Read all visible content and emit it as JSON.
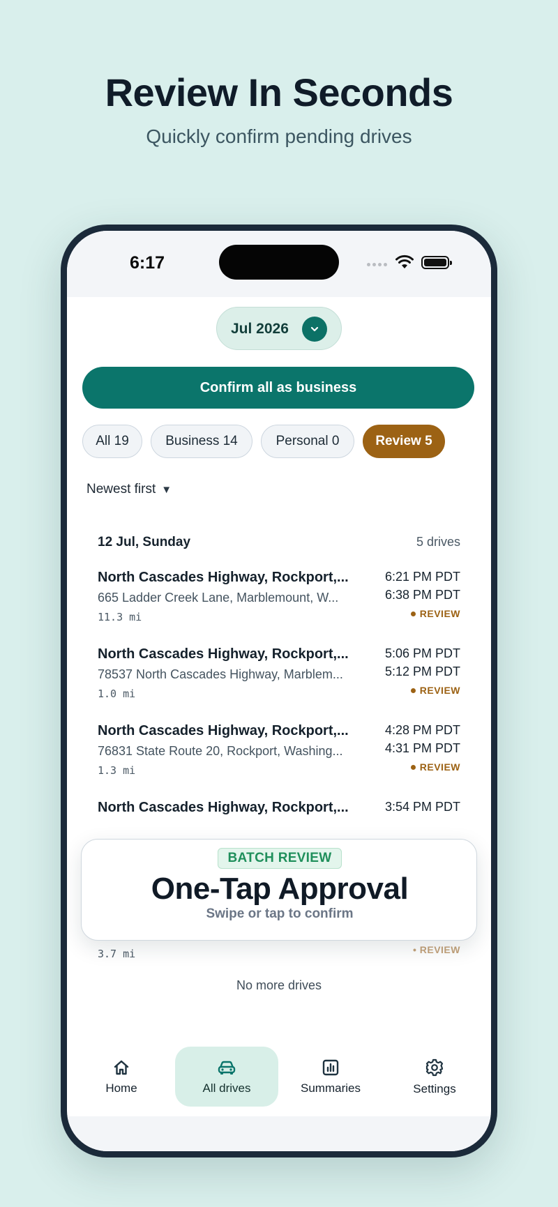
{
  "promo": {
    "headline": "Review In Seconds",
    "subheadline": "Quickly confirm pending drives"
  },
  "status_bar": {
    "time": "6:17"
  },
  "month_selector": {
    "label": "Jul 2026"
  },
  "confirm_all_label": "Confirm all as business",
  "filters": [
    {
      "label": "All 19",
      "active": false
    },
    {
      "label": "Business 14",
      "active": false
    },
    {
      "label": "Personal 0",
      "active": false
    },
    {
      "label": "Review 5",
      "active": true
    }
  ],
  "sort": {
    "label": "Newest first",
    "indicator": "▼"
  },
  "day_group": {
    "title": "12 Jul, Sunday",
    "count": "5 drives"
  },
  "drives": [
    {
      "title": "North Cascades Highway, Rockport,...",
      "destination": "665 Ladder Creek Lane, Marblemount, W...",
      "distance": "11.3 mi",
      "start": "6:21 PM PDT",
      "end": "6:38 PM PDT",
      "status": "REVIEW"
    },
    {
      "title": "North Cascades Highway, Rockport,...",
      "destination": "78537 North Cascades Highway, Marblem...",
      "distance": "1.0 mi",
      "start": "5:06 PM PDT",
      "end": "5:12 PM PDT",
      "status": "REVIEW"
    },
    {
      "title": "North Cascades Highway, Rockport,...",
      "destination": "76831 State Route 20, Rockport, Washing...",
      "distance": "1.3 mi",
      "start": "4:28 PM PDT",
      "end": "4:31 PM PDT",
      "status": "REVIEW"
    },
    {
      "title": "North Cascades Highway, Rockport,...",
      "start": "3:54 PM PDT"
    }
  ],
  "peek_row": {
    "distance": "3.7 mi",
    "status": "• REVIEW"
  },
  "overlay": {
    "badge": "BATCH REVIEW",
    "title": "One-Tap Approval",
    "subtitle": "Swipe or tap to confirm"
  },
  "list_end": "No more drives",
  "tabs": [
    {
      "label": "Home",
      "icon": "home-icon",
      "active": false
    },
    {
      "label": "All drives",
      "icon": "car-icon",
      "active": true
    },
    {
      "label": "Summaries",
      "icon": "bar-chart-icon",
      "active": false
    },
    {
      "label": "Settings",
      "icon": "gear-icon",
      "active": false
    }
  ],
  "colors": {
    "background": "#d9efec",
    "brand_teal": "#0b756b",
    "review_amber": "#9c6214",
    "active_tab_bg": "#d8efe8"
  }
}
